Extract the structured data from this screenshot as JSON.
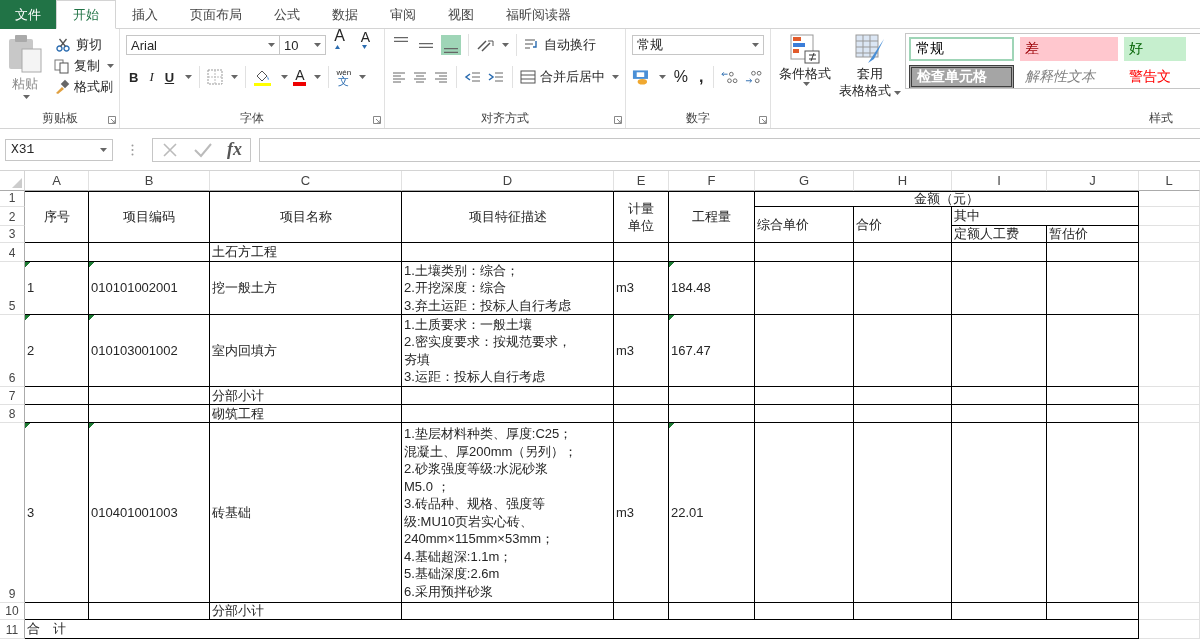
{
  "ribbon_tabs": [
    {
      "label": "文件",
      "kind": "file",
      "selected": false
    },
    {
      "label": "开始",
      "kind": "tab",
      "selected": true
    },
    {
      "label": "插入",
      "kind": "tab",
      "selected": false
    },
    {
      "label": "页面布局",
      "kind": "tab",
      "selected": false
    },
    {
      "label": "公式",
      "kind": "tab",
      "selected": false
    },
    {
      "label": "数据",
      "kind": "tab",
      "selected": false
    },
    {
      "label": "审阅",
      "kind": "tab",
      "selected": false
    },
    {
      "label": "视图",
      "kind": "tab",
      "selected": false
    },
    {
      "label": "福昕阅读器",
      "kind": "tab",
      "selected": false
    }
  ],
  "clipboard": {
    "paste": "粘贴",
    "cut": "剪切",
    "copy": "复制",
    "format_painter": "格式刷",
    "label": "剪贴板"
  },
  "font": {
    "name": "Arial",
    "size": "10",
    "grow": "A",
    "shrink": "A",
    "bold": "B",
    "italic": "I",
    "underline": "U",
    "font_color": "A",
    "phonetic_top": "wén",
    "phonetic_bottom": "文",
    "label": "字体"
  },
  "alignment": {
    "buttons": [
      {
        "kind": "top",
        "selected": false
      },
      {
        "kind": "middle",
        "selected": false
      },
      {
        "kind": "bottom",
        "selected": true
      }
    ],
    "wrap": "自动换行",
    "merge": "合并后居中",
    "label": "对齐方式"
  },
  "number": {
    "format": "常规",
    "percent": "%",
    "comma": ",",
    "label": "数字"
  },
  "styles": {
    "conditional": "条件格式",
    "table_format": [
      "套用",
      "表格格式"
    ],
    "label": "样式",
    "gallery": [
      {
        "label": "常规",
        "kind": "normal",
        "selected": true
      },
      {
        "label": "差",
        "kind": "bad",
        "selected": false
      },
      {
        "label": "好",
        "kind": "good",
        "selected": false
      },
      {
        "label": "检查单元格",
        "kind": "check",
        "selected": false
      },
      {
        "label": "解释性文本",
        "kind": "explanatory",
        "selected": false
      },
      {
        "label": "警告文",
        "kind": "warning",
        "selected": false
      }
    ]
  },
  "formula_bar": {
    "name_box": "X31",
    "fx": "fx"
  },
  "sheet": {
    "columns": [
      "A",
      "B",
      "C",
      "D",
      "E",
      "F",
      "G",
      "H",
      "I",
      "J",
      "L"
    ],
    "rows": [
      {
        "number": "1",
        "cells": [
          {
            "text": "序号",
            "rowspan": 3
          },
          {
            "text": "项目编码",
            "rowspan": 3
          },
          {
            "text": "项目名称",
            "rowspan": 3
          },
          {
            "text": "项目特征描述",
            "rowspan": 3
          },
          {
            "lines": [
              "计量",
              "单位"
            ],
            "rowspan": 3
          },
          {
            "text": "工程量",
            "rowspan": 3
          },
          {
            "text": "金额（元）",
            "colspan": 4
          },
          {
            "text": ""
          }
        ]
      },
      {
        "number": "2",
        "cells": [
          {
            "text": "综合单价",
            "rowspan": 2
          },
          {
            "text": "合价",
            "rowspan": 2
          },
          {
            "text": "其中",
            "colspan": 2
          },
          {
            "text": ""
          }
        ]
      },
      {
        "number": "3",
        "cells": [
          {
            "text": "定额人工费"
          },
          {
            "text": "暂估价"
          },
          {
            "text": ""
          }
        ]
      },
      {
        "number": "4",
        "cells": [
          {
            "text": ""
          },
          {
            "text": ""
          },
          {
            "text": "土石方工程"
          },
          {
            "text": ""
          },
          {
            "text": ""
          },
          {
            "text": ""
          },
          {
            "text": ""
          },
          {
            "text": ""
          },
          {
            "text": ""
          },
          {
            "text": ""
          },
          {
            "text": ""
          }
        ]
      },
      {
        "number": "5",
        "cells": [
          {
            "text": "1",
            "flagged": true
          },
          {
            "text": "010101002001",
            "flagged": true
          },
          {
            "text": "挖一般土方",
            "flagged": false
          },
          {
            "lines": [
              "1.土壤类别：综合；",
              "2.开挖深度：综合",
              "3.弃土运距：投标人自行考虑"
            ],
            "flagged": false
          },
          {
            "text": "m3",
            "flagged": false
          },
          {
            "text": "184.48",
            "flagged": true
          },
          {
            "text": ""
          },
          {
            "text": ""
          },
          {
            "text": ""
          },
          {
            "text": ""
          },
          {
            "text": ""
          }
        ]
      },
      {
        "number": "6",
        "cells": [
          {
            "text": "2",
            "flagged": true
          },
          {
            "text": "010103001002",
            "flagged": true
          },
          {
            "text": "室内回填方",
            "flagged": false
          },
          {
            "lines": [
              "1.土质要求：一般土壤",
              "2.密实度要求：按规范要求，",
              "夯填",
              "3.运距：投标人自行考虑"
            ],
            "flagged": false
          },
          {
            "text": "m3",
            "flagged": false
          },
          {
            "text": "167.47",
            "flagged": true
          },
          {
            "text": ""
          },
          {
            "text": ""
          },
          {
            "text": ""
          },
          {
            "text": ""
          },
          {
            "text": ""
          }
        ]
      },
      {
        "number": "7",
        "cells": [
          {
            "text": ""
          },
          {
            "text": ""
          },
          {
            "text": "分部小计"
          },
          {
            "text": ""
          },
          {
            "text": ""
          },
          {
            "text": ""
          },
          {
            "text": ""
          },
          {
            "text": ""
          },
          {
            "text": ""
          },
          {
            "text": ""
          },
          {
            "text": ""
          }
        ]
      },
      {
        "number": "8",
        "cells": [
          {
            "text": ""
          },
          {
            "text": ""
          },
          {
            "text": "砌筑工程"
          },
          {
            "text": ""
          },
          {
            "text": ""
          },
          {
            "text": ""
          },
          {
            "text": ""
          },
          {
            "text": ""
          },
          {
            "text": ""
          },
          {
            "text": ""
          },
          {
            "text": ""
          }
        ]
      },
      {
        "number": "9",
        "cells": [
          {
            "text": "3",
            "flagged": true
          },
          {
            "text": "010401001003",
            "flagged": true
          },
          {
            "text": "砖基础",
            "flagged": false
          },
          {
            "lines": [
              "1.垫层材料种类、厚度:C25；",
              "混凝土、厚200mm（另列）；",
              "2.砂浆强度等级:水泥砂浆",
              "M5.0 ；",
              "3.砖品种、规格、强度等",
              "级:MU10页岩实心砖、",
              "240mm×115mm×53mm；",
              "4.基础超深:1.1m；",
              "5.基础深度:2.6m",
              "6.采用预拌砂浆"
            ],
            "flagged": false
          },
          {
            "text": "m3",
            "flagged": false
          },
          {
            "text": "22.01",
            "flagged": true
          },
          {
            "text": ""
          },
          {
            "text": ""
          },
          {
            "text": ""
          },
          {
            "text": ""
          },
          {
            "text": ""
          }
        ]
      },
      {
        "number": "10",
        "cells": [
          {
            "text": ""
          },
          {
            "text": ""
          },
          {
            "text": "分部小计"
          },
          {
            "text": ""
          },
          {
            "text": ""
          },
          {
            "text": ""
          },
          {
            "text": ""
          },
          {
            "text": ""
          },
          {
            "text": ""
          },
          {
            "text": ""
          },
          {
            "text": ""
          }
        ]
      },
      {
        "number": "11",
        "cells": [
          {
            "text": "合　计",
            "colspan": 10
          },
          {
            "text": ""
          }
        ]
      }
    ]
  }
}
